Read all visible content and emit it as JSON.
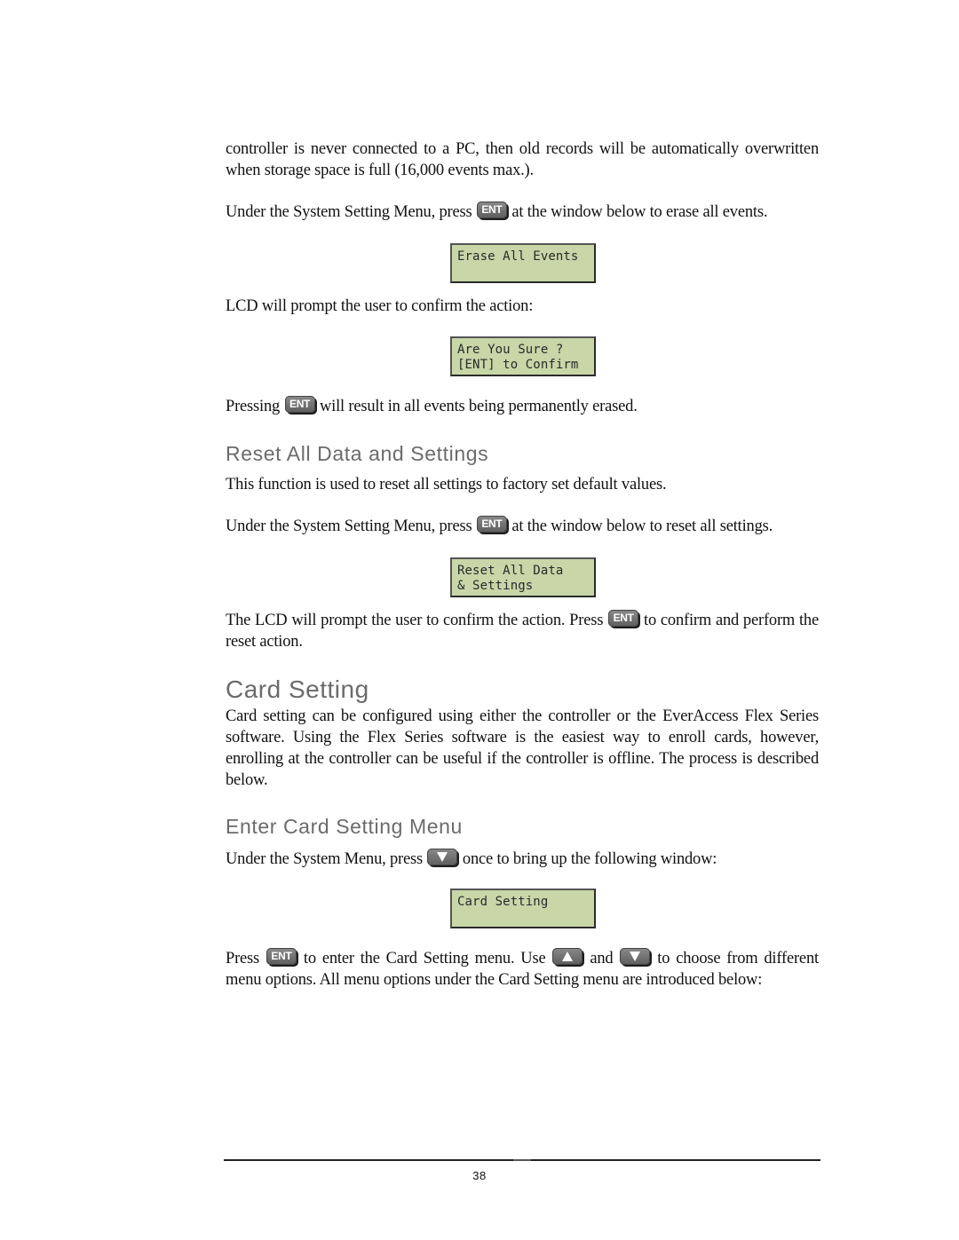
{
  "paragraphs": {
    "p1": "controller is never connected to a PC, then old records will be automatically overwritten when storage space is full (16,000 events max.).",
    "p2_before": "Under the System Setting Menu, press",
    "p2_after": "at the window below to erase all events.",
    "p3": "LCD will prompt the user to confirm the action:",
    "p4_before": "Pressing",
    "p4_after": "will result in all events being permanently erased.",
    "p5": "This function is used to reset all settings to factory set default values.",
    "p6_before": "Under the System Setting Menu, press",
    "p6_after": "at the window below to reset all settings.",
    "p7_before": "The LCD will prompt the user to confirm the action. Press",
    "p7_after": "to confirm and perform the reset action.",
    "p8": "Card setting can be configured using either the controller or the EverAccess Flex Series software. Using the Flex Series software is the easiest way to enroll cards, however, enrolling at the controller can be useful if the controller is offline.  The process is described below.",
    "p9_before": "Under the System Menu, press",
    "p9_after": "once to bring up the following window:",
    "p10_a": "Press",
    "p10_b": "to enter the Card Setting menu. Use",
    "p10_c": "and",
    "p10_d": "to choose from different menu options. All menu options under the Card Setting menu are introduced below:"
  },
  "headings": {
    "reset_all": "Reset All Data and Settings",
    "card_setting": "Card Setting",
    "enter_card_menu": "Enter Card Setting Menu"
  },
  "lcd": {
    "erase": [
      "Erase All Events",
      ""
    ],
    "confirm": [
      "Are You Sure ?",
      "[ENT] to Confirm"
    ],
    "reset": [
      "Reset All Data",
      "& Settings"
    ],
    "card": [
      "Card Setting",
      ""
    ]
  },
  "keys": {
    "ent": "ENT",
    "up": "up-arrow",
    "down": "down-arrow"
  },
  "colors": {
    "lcd_background": "#c8d6a8",
    "heading_gray": "#6b6b6b",
    "key_gray": "#6e6e6e"
  },
  "footer": {
    "page_number": "38"
  }
}
